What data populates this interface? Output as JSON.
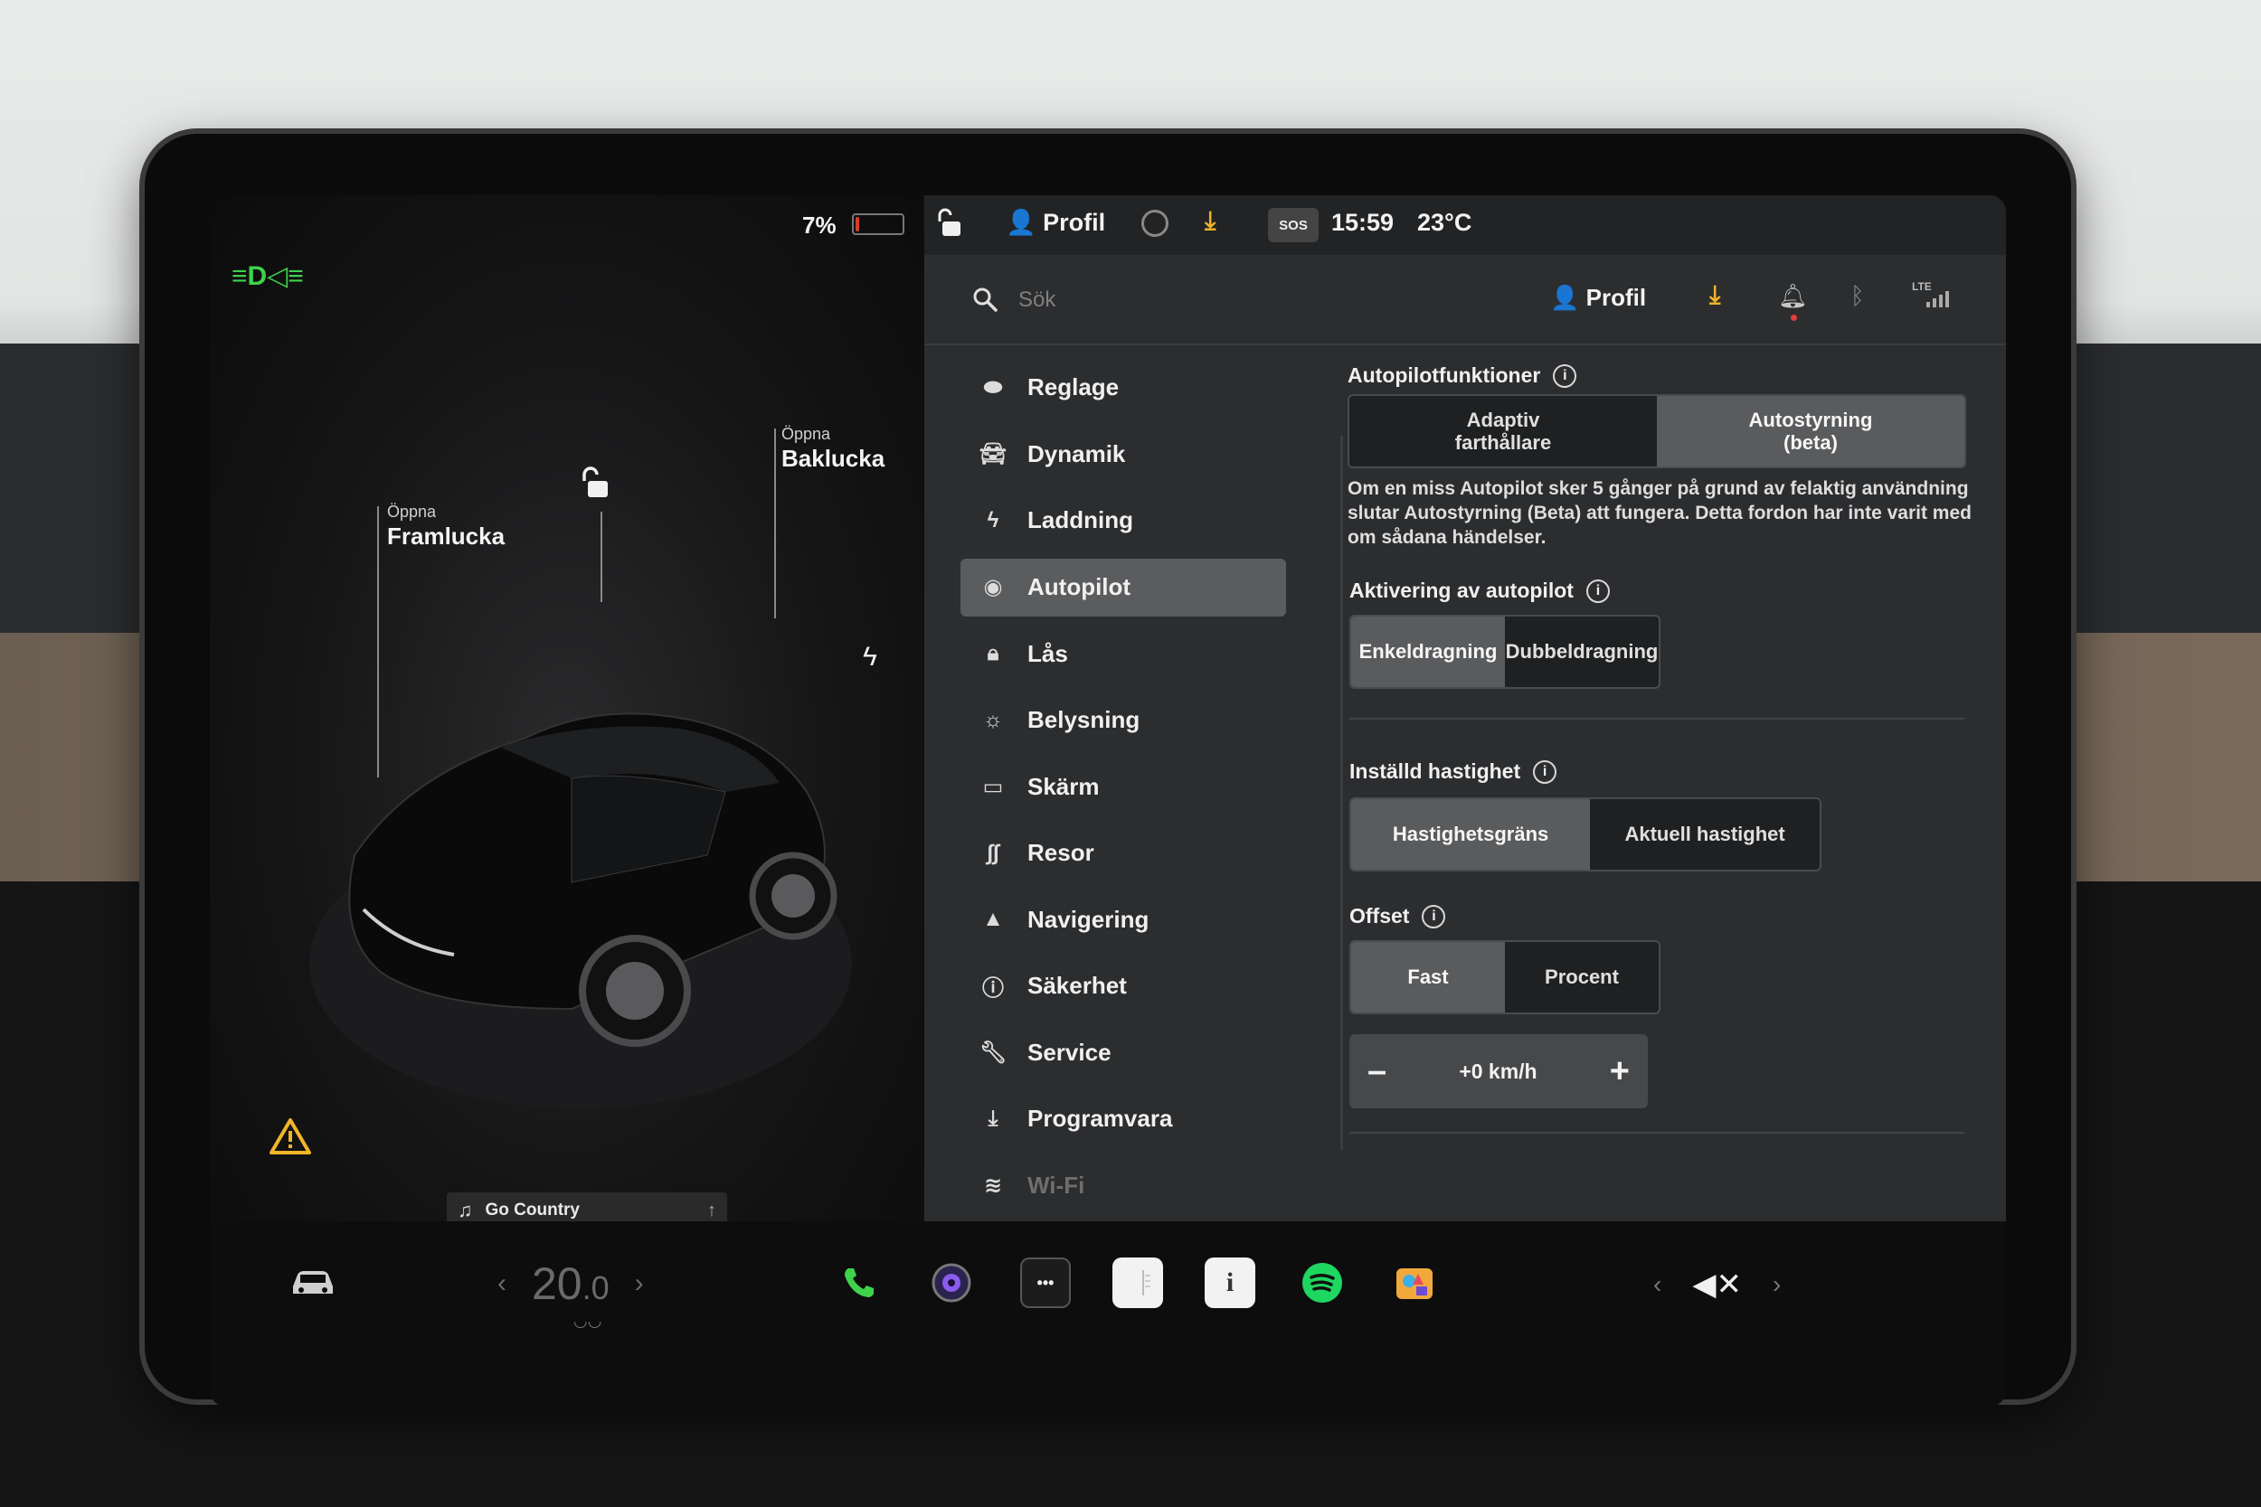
{
  "status": {
    "battery_percent_label": "7%",
    "battery_level": 0.07,
    "topbar_profile": "Profil",
    "sos": "SOS",
    "time": "15:59",
    "temperature": "23°C"
  },
  "car": {
    "frunk_small": "Öppna",
    "frunk_title": "Framlucka",
    "trunk_small": "Öppna",
    "trunk_title": "Baklucka"
  },
  "media": {
    "now_playing": "Go Country"
  },
  "search": {
    "placeholder": "Sök",
    "profile": "Profil"
  },
  "menu": [
    {
      "label": "Reglage",
      "icon": "toggle-icon"
    },
    {
      "label": "Dynamik",
      "icon": "car-icon"
    },
    {
      "label": "Laddning",
      "icon": "bolt-icon"
    },
    {
      "label": "Autopilot",
      "icon": "steering-wheel-icon",
      "active": true
    },
    {
      "label": "Lås",
      "icon": "lock-icon"
    },
    {
      "label": "Belysning",
      "icon": "sun-icon"
    },
    {
      "label": "Skärm",
      "icon": "display-icon"
    },
    {
      "label": "Resor",
      "icon": "trips-icon"
    },
    {
      "label": "Navigering",
      "icon": "navigation-icon"
    },
    {
      "label": "Säkerhet",
      "icon": "safety-icon"
    },
    {
      "label": "Service",
      "icon": "wrench-icon"
    },
    {
      "label": "Programvara",
      "icon": "download-icon"
    },
    {
      "label": "Wi-Fi",
      "icon": "wifi-icon"
    }
  ],
  "autopilot": {
    "features_title": "Autopilotfunktioner",
    "features_options": [
      "Adaptiv\nfarthållare",
      "Autostyrning\n(beta)"
    ],
    "features_selected": 1,
    "features_desc": "Om en miss Autopilot sker 5 gånger på grund av felaktig användning slutar Autostyrning (Beta) att fungera. Detta fordon har inte varit med om sådana händelser.",
    "activation_title": "Aktivering av autopilot",
    "activation_options": [
      "Enkeldragning",
      "Dubbeldragning"
    ],
    "activation_selected": 0,
    "speed_title": "Inställd hastighet",
    "speed_options": [
      "Hastighetsgräns",
      "Aktuell hastighet"
    ],
    "speed_selected": 0,
    "offset_title": "Offset",
    "offset_options": [
      "Fast",
      "Procent"
    ],
    "offset_selected": 0,
    "offset_value": "+0 km/h",
    "minus": "–",
    "plus": "+"
  },
  "dock": {
    "temp_main": "20",
    "temp_decimal": ".0",
    "left_arrow": "‹",
    "right_arrow": "›",
    "dots": "•••",
    "info": "i",
    "vol_left": "‹",
    "vol_right": "›",
    "mute": "◀✕"
  },
  "colors": {
    "accent_green": "#3fd24b",
    "download_amber": "#f0b429",
    "battery_red": "#d93b2b"
  }
}
